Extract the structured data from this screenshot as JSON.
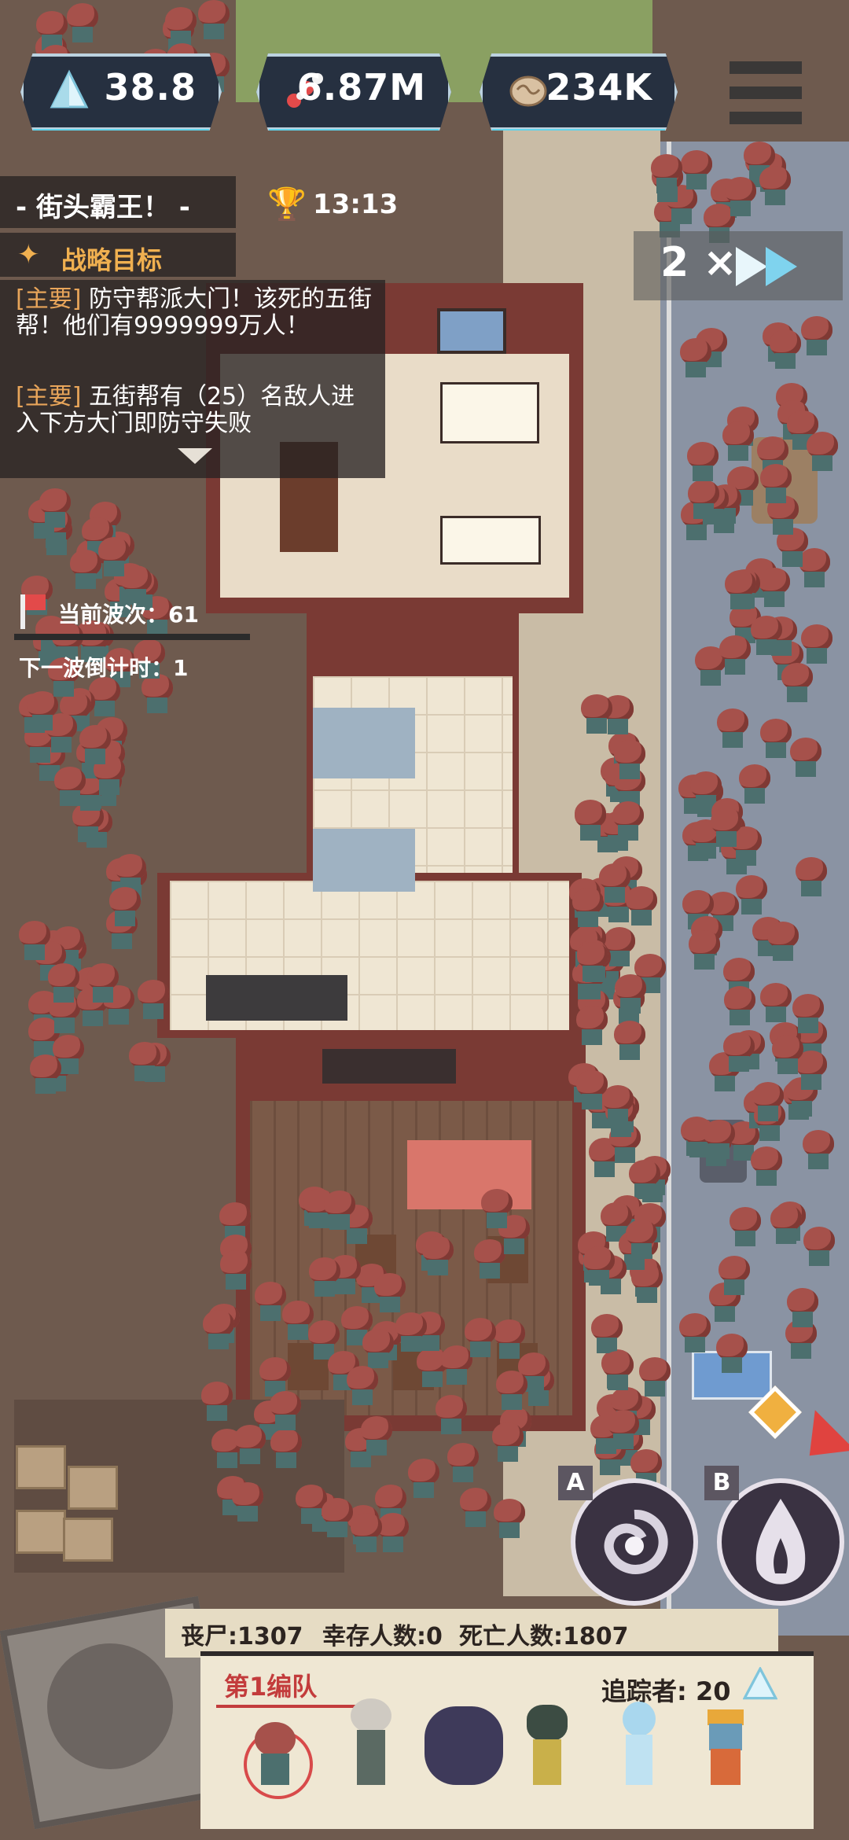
{
  "resources": [
    {
      "name": "crystal",
      "icon": "crystal-icon",
      "value": "38.8"
    },
    {
      "name": "dna",
      "icon": "dna-icon",
      "value": "6.87M"
    },
    {
      "name": "brain",
      "icon": "brain-icon",
      "value": "234K"
    }
  ],
  "quest": {
    "title": "- 街头霸王！ -",
    "timer": "13:13",
    "objective_label": "战略目标",
    "entries": [
      {
        "tag": "[主要]",
        "text": "防守帮派大门！该死的五街帮！他们有9999999万人！"
      },
      {
        "tag": "[主要]",
        "text": "五街帮有（25）名敌人进入下方大门即防守失败"
      }
    ]
  },
  "wave": {
    "current_label": "当前波次：61",
    "countdown_label": "下一波倒计时：1"
  },
  "speed": {
    "label": "2 ×"
  },
  "skills": [
    {
      "key": "A",
      "icon": "spiral-skill-icon"
    },
    {
      "key": "B",
      "icon": "flame-skill-icon"
    }
  ],
  "stats": {
    "zombies": "丧尸:1307",
    "survivors": "幸存人数:0",
    "dead": "死亡人数:1807"
  },
  "squad": {
    "name": "第1编队",
    "tracker": "追踪者: 20"
  },
  "colors": {
    "accent": "#5fd3ec",
    "zombie": "#a6514b",
    "wall": "#7a3a34",
    "quest_tag": "#e8a55a"
  }
}
